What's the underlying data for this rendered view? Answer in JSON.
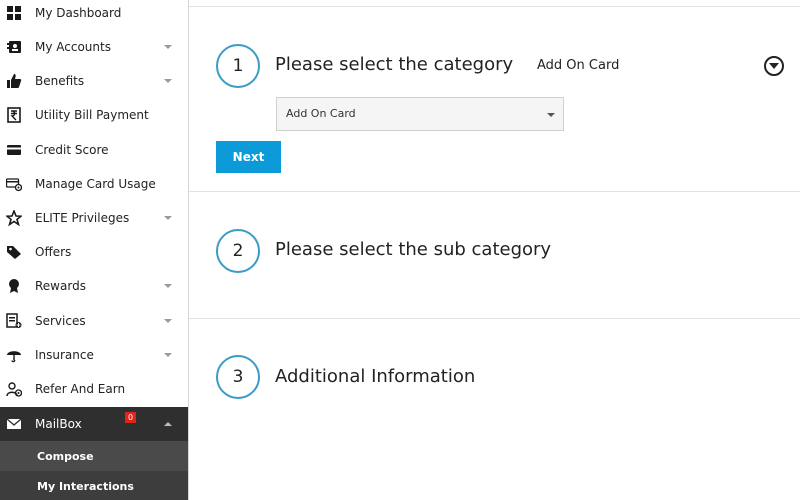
{
  "sidebar": {
    "items": [
      {
        "label": "My Dashboard",
        "icon": "dashboard-grid-icon",
        "has_caret": false
      },
      {
        "label": "My Accounts",
        "icon": "account-card-icon",
        "has_caret": true
      },
      {
        "label": "Benefits",
        "icon": "thumbs-up-icon",
        "has_caret": true
      },
      {
        "label": "Utility Bill Payment",
        "icon": "rupee-bill-icon",
        "has_caret": false
      },
      {
        "label": "Credit Score",
        "icon": "credit-card-icon",
        "has_caret": false
      },
      {
        "label": "Manage Card Usage",
        "icon": "card-settings-icon",
        "has_caret": false
      },
      {
        "label": "ELITE Privileges",
        "icon": "star-icon",
        "has_caret": true
      },
      {
        "label": "Offers",
        "icon": "tag-icon",
        "has_caret": false
      },
      {
        "label": "Rewards",
        "icon": "medal-icon",
        "has_caret": true
      },
      {
        "label": "Services",
        "icon": "services-list-icon",
        "has_caret": true
      },
      {
        "label": "Insurance",
        "icon": "umbrella-icon",
        "has_caret": true
      },
      {
        "label": "Refer And Earn",
        "icon": "refer-user-icon",
        "has_caret": false
      }
    ],
    "mailbox": {
      "label": "MailBox",
      "icon": "envelope-icon",
      "badge": "0"
    },
    "mailbox_sub": [
      {
        "label": "Compose"
      },
      {
        "label": "My Interactions"
      }
    ]
  },
  "steps": [
    {
      "number": "1",
      "title": "Please select the category",
      "selected": "Add On Card"
    },
    {
      "number": "2",
      "title": "Please select the sub category"
    },
    {
      "number": "3",
      "title": "Additional Information"
    }
  ],
  "category_select": {
    "value": "Add On Card"
  },
  "next_label": "Next",
  "colors": {
    "accent": "#0d9ad9",
    "step_ring": "#3a9bc4",
    "sidebar_active": "#2f2f2f",
    "badge": "#e2231a"
  }
}
